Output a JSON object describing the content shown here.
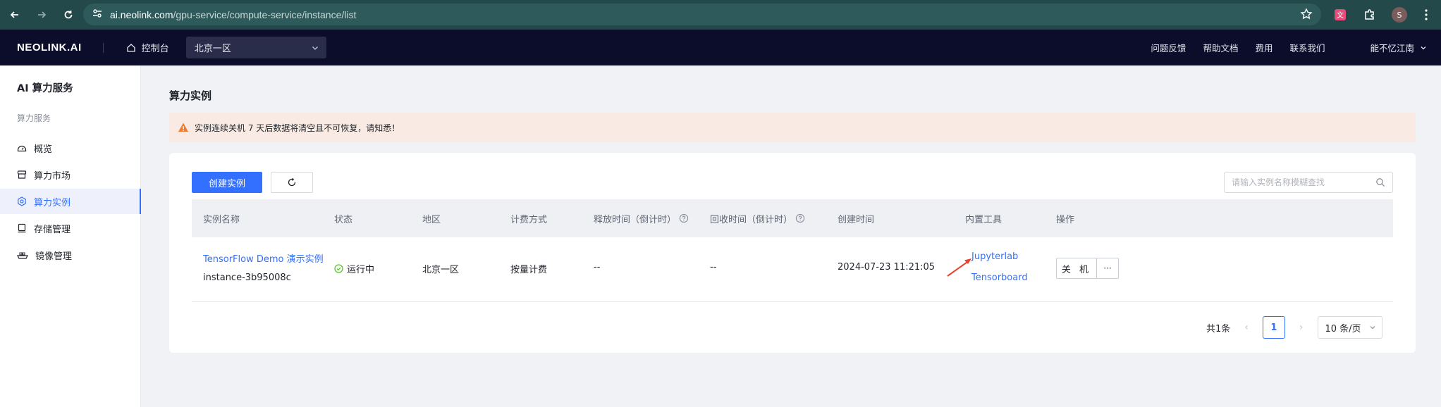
{
  "browser": {
    "url_domain": "ai.neolink.com",
    "url_path": "/gpu-service/compute-service/instance/list",
    "profile_initial": "S"
  },
  "header": {
    "logo": "NEOLINK.AI",
    "console_label": "控制台",
    "region": "北京一区",
    "links": [
      "问题反馈",
      "帮助文档",
      "费用",
      "联系我们"
    ],
    "user": "能不忆江南"
  },
  "sidebar": {
    "title": "AI 算力服务",
    "section": "算力服务",
    "items": [
      {
        "label": "概览",
        "icon": "dashboard-icon"
      },
      {
        "label": "算力市场",
        "icon": "market-icon"
      },
      {
        "label": "算力实例",
        "icon": "instance-icon",
        "active": true
      },
      {
        "label": "存储管理",
        "icon": "storage-icon"
      },
      {
        "label": "镜像管理",
        "icon": "image-icon"
      }
    ]
  },
  "main": {
    "title": "算力实例",
    "alert": "实例连续关机 7 天后数据将清空且不可恢复，请知悉！",
    "create_button": "创建实例",
    "search_placeholder": "请输入实例名称模糊查找",
    "columns": [
      "实例名称",
      "状态",
      "地区",
      "计费方式",
      "释放时间（倒计时）",
      "回收时间（倒计时）",
      "创建时间",
      "内置工具",
      "操作"
    ],
    "rows": [
      {
        "name": "TensorFlow Demo 演示实例",
        "id": "instance-3b95008c",
        "status": "运行中",
        "region": "北京一区",
        "billing": "按量计费",
        "release_time": "--",
        "recycle_time": "--",
        "created": "2024-07-23 11:21:05",
        "tools": [
          "Jupyterlab",
          "Tensorboard"
        ],
        "action": "关 机",
        "more": "···"
      }
    ],
    "pagination": {
      "total": "共1条",
      "current": "1",
      "page_size": "10 条/页"
    }
  },
  "colors": {
    "primary": "#3370ff",
    "header_bg": "#0b0d2a",
    "browser_bg": "#24494a",
    "alert_bg": "#f9ebe3",
    "status_green": "#52c41a",
    "annotation_red": "#e8412c"
  }
}
